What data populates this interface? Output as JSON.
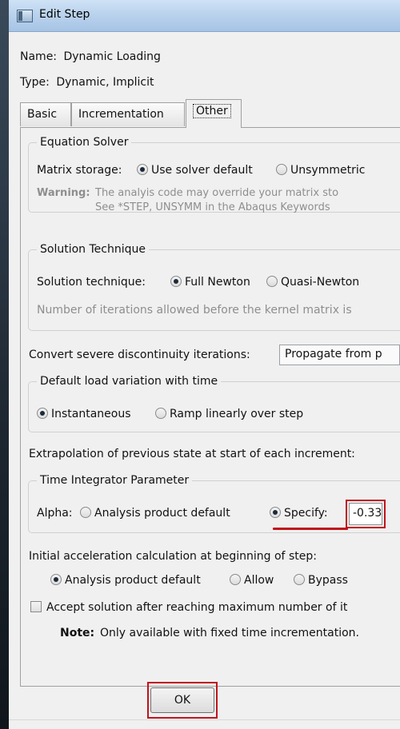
{
  "window": {
    "title": "Edit Step"
  },
  "step": {
    "name_label": "Name:",
    "name_value": "Dynamic Loading",
    "type_label": "Type:",
    "type_value": "Dynamic, Implicit"
  },
  "tabs": [
    {
      "label": "Basic",
      "active": false
    },
    {
      "label": "Incrementation",
      "active": false
    },
    {
      "label": "Other",
      "active": true
    }
  ],
  "equation_solver": {
    "legend": "Equation Solver",
    "matrix_storage_label": "Matrix storage:",
    "options": [
      "Use solver default",
      "Unsymmetric"
    ],
    "selected": "Use solver default",
    "warning_label": "Warning:",
    "warning_line1": "The analyis code may override your matrix sto",
    "warning_line2": "See *STEP, UNSYMM in the Abaqus Keywords"
  },
  "solution_technique": {
    "legend": "Solution Technique",
    "label": "Solution technique:",
    "options": [
      "Full Newton",
      "Quasi-Newton"
    ],
    "selected": "Full Newton",
    "iterations_text": "Number of iterations allowed before the kernel matrix is"
  },
  "discontinuity": {
    "label": "Convert severe discontinuity iterations:",
    "value": "Propagate from p"
  },
  "load_variation": {
    "legend": "Default load variation with time",
    "options": [
      "Instantaneous",
      "Ramp linearly over step"
    ],
    "selected": "Instantaneous"
  },
  "extrapolation": {
    "label": "Extrapolation of previous state at start of each increment:"
  },
  "time_integrator": {
    "legend": "Time Integrator Parameter",
    "alpha_label": "Alpha:",
    "options": [
      "Analysis product default",
      "Specify:"
    ],
    "selected": "Specify:",
    "alpha_value": "-0.33"
  },
  "initial_acceleration": {
    "label": "Initial acceleration calculation at beginning of step:",
    "options": [
      "Analysis product default",
      "Allow",
      "Bypass"
    ],
    "selected": "Analysis product default"
  },
  "accept_solution": {
    "label": "Accept solution after reaching maximum number of it",
    "checked": false
  },
  "note": {
    "label": "Note:",
    "text": "Only available with fixed time incrementation."
  },
  "buttons": {
    "ok": "OK"
  },
  "colors": {
    "highlight": "#c0141c",
    "titlebar": "#b8d1ec",
    "dialog_bg": "#f0f0f0"
  }
}
